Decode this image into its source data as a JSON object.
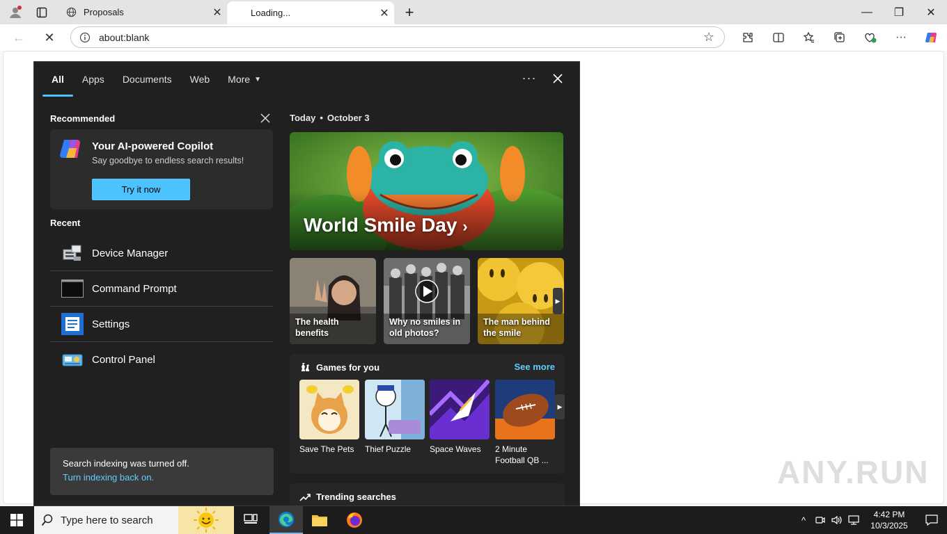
{
  "browser": {
    "tabs": [
      {
        "title": "Proposals",
        "active": false
      },
      {
        "title": "Loading...",
        "active": true
      }
    ],
    "address": "about:blank"
  },
  "search_panel": {
    "tabs": [
      "All",
      "Apps",
      "Documents",
      "Web",
      "More"
    ],
    "active_tab": "All",
    "recommended": {
      "heading": "Recommended",
      "copilot_title": "Your AI-powered Copilot",
      "copilot_subtitle": "Say goodbye to endless search results!",
      "button": "Try it now"
    },
    "recent": {
      "heading": "Recent",
      "items": [
        {
          "label": "Device Manager",
          "icon": "device-manager-icon"
        },
        {
          "label": "Command Prompt",
          "icon": "command-prompt-icon"
        },
        {
          "label": "Settings",
          "icon": "settings-icon"
        },
        {
          "label": "Control Panel",
          "icon": "control-panel-icon"
        }
      ]
    },
    "indexing": {
      "message": "Search indexing was turned off.",
      "link": "Turn indexing back on."
    },
    "today": {
      "label": "Today",
      "date": "October 3"
    },
    "hero": {
      "title": "World Smile Day"
    },
    "news": [
      {
        "title": "The health benefits"
      },
      {
        "title": "Why no smiles in old photos?"
      },
      {
        "title": "The man behind the smile"
      }
    ],
    "games": {
      "heading": "Games for you",
      "see_more": "See more",
      "items": [
        {
          "name": "Save The Pets"
        },
        {
          "name": "Thief Puzzle"
        },
        {
          "name": "Space Waves"
        },
        {
          "name": "2 Minute Football QB ..."
        }
      ]
    },
    "trending": {
      "heading": "Trending searches"
    }
  },
  "taskbar": {
    "search_placeholder": "Type here to search",
    "time": "4:42 PM",
    "date": "10/3/2025"
  },
  "watermark": "ANY.RUN",
  "colors": {
    "accent": "#4cc2ff",
    "link": "#60cdff",
    "panel_bg": "#202020"
  }
}
